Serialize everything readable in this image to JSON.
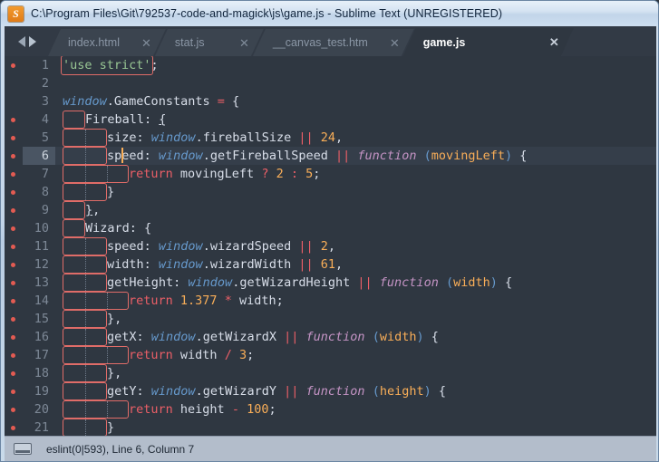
{
  "window": {
    "title": "C:\\Program Files\\Git\\792537-code-and-magick\\js\\game.js - Sublime Text (UNREGISTERED)",
    "app_icon": "sublime-text-logo"
  },
  "tabbar": {
    "nav_prev_icon": "arrow-left-icon",
    "nav_next_icon": "arrow-right-icon",
    "close_glyph": "✕",
    "tabs": [
      {
        "label": "index.html",
        "active": false
      },
      {
        "label": "stat.js",
        "active": false
      },
      {
        "label": "__canvas_test.htm",
        "active": false
      },
      {
        "label": "game.js",
        "active": true
      }
    ]
  },
  "editor": {
    "current_line": 6,
    "lines": [
      {
        "num": "1",
        "error": true,
        "current": false
      },
      {
        "num": "2",
        "error": false,
        "current": false
      },
      {
        "num": "3",
        "error": false,
        "current": false
      },
      {
        "num": "4",
        "error": true,
        "current": false
      },
      {
        "num": "5",
        "error": true,
        "current": false
      },
      {
        "num": "6",
        "error": true,
        "current": true
      },
      {
        "num": "7",
        "error": true,
        "current": false
      },
      {
        "num": "8",
        "error": true,
        "current": false
      },
      {
        "num": "9",
        "error": true,
        "current": false
      },
      {
        "num": "10",
        "error": true,
        "current": false
      },
      {
        "num": "11",
        "error": true,
        "current": false
      },
      {
        "num": "12",
        "error": true,
        "current": false
      },
      {
        "num": "13",
        "error": true,
        "current": false
      },
      {
        "num": "14",
        "error": true,
        "current": false
      },
      {
        "num": "15",
        "error": true,
        "current": false
      },
      {
        "num": "16",
        "error": true,
        "current": false
      },
      {
        "num": "17",
        "error": true,
        "current": false
      },
      {
        "num": "18",
        "error": true,
        "current": false
      },
      {
        "num": "19",
        "error": true,
        "current": false
      },
      {
        "num": "20",
        "error": true,
        "current": false
      },
      {
        "num": "21",
        "error": true,
        "current": false
      }
    ],
    "source_text": [
      "'use strict';",
      "",
      "window.GameConstants = {",
      "    Fireball: {",
      "        size: window.fireballSize || 24,",
      "        speed: window.getFireballSpeed || function (movingLeft) {",
      "            return movingLeft ? 2 : 5;",
      "        }",
      "    },",
      "    Wizard: {",
      "        speed: window.wizardSpeed || 2,",
      "        width: window.wizardWidth || 61,",
      "        getHeight: window.getWizardHeight || function (width) {",
      "            return 1.377 * width;",
      "        },",
      "        getX: window.getWizardX || function (width) {",
      "            return width / 3;",
      "        },",
      "        getY: window.getWizardY || function (height) {",
      "            return height - 100;",
      "        },",
      "        }"
    ]
  },
  "statusbar": {
    "console_icon": "console-panel-icon",
    "text": "eslint(0|593), Line 6, Column 7"
  },
  "colors": {
    "titlebar_text": "#11243b",
    "editor_bg": "#2f3741",
    "tabbar_bg": "#323a45",
    "active_tab_bg": "#2f3741",
    "gutter_error_dot": "#e35b52",
    "indent_guide_box": "#e06c68",
    "caret": "#f9ae58",
    "string": "#99c794",
    "variable": "#6699cc",
    "keyword": "#c594c5",
    "number": "#f9ae58",
    "operator": "#ec5f67",
    "plain": "#d8dee9",
    "statusbar_bg": "#b3bdcb"
  }
}
